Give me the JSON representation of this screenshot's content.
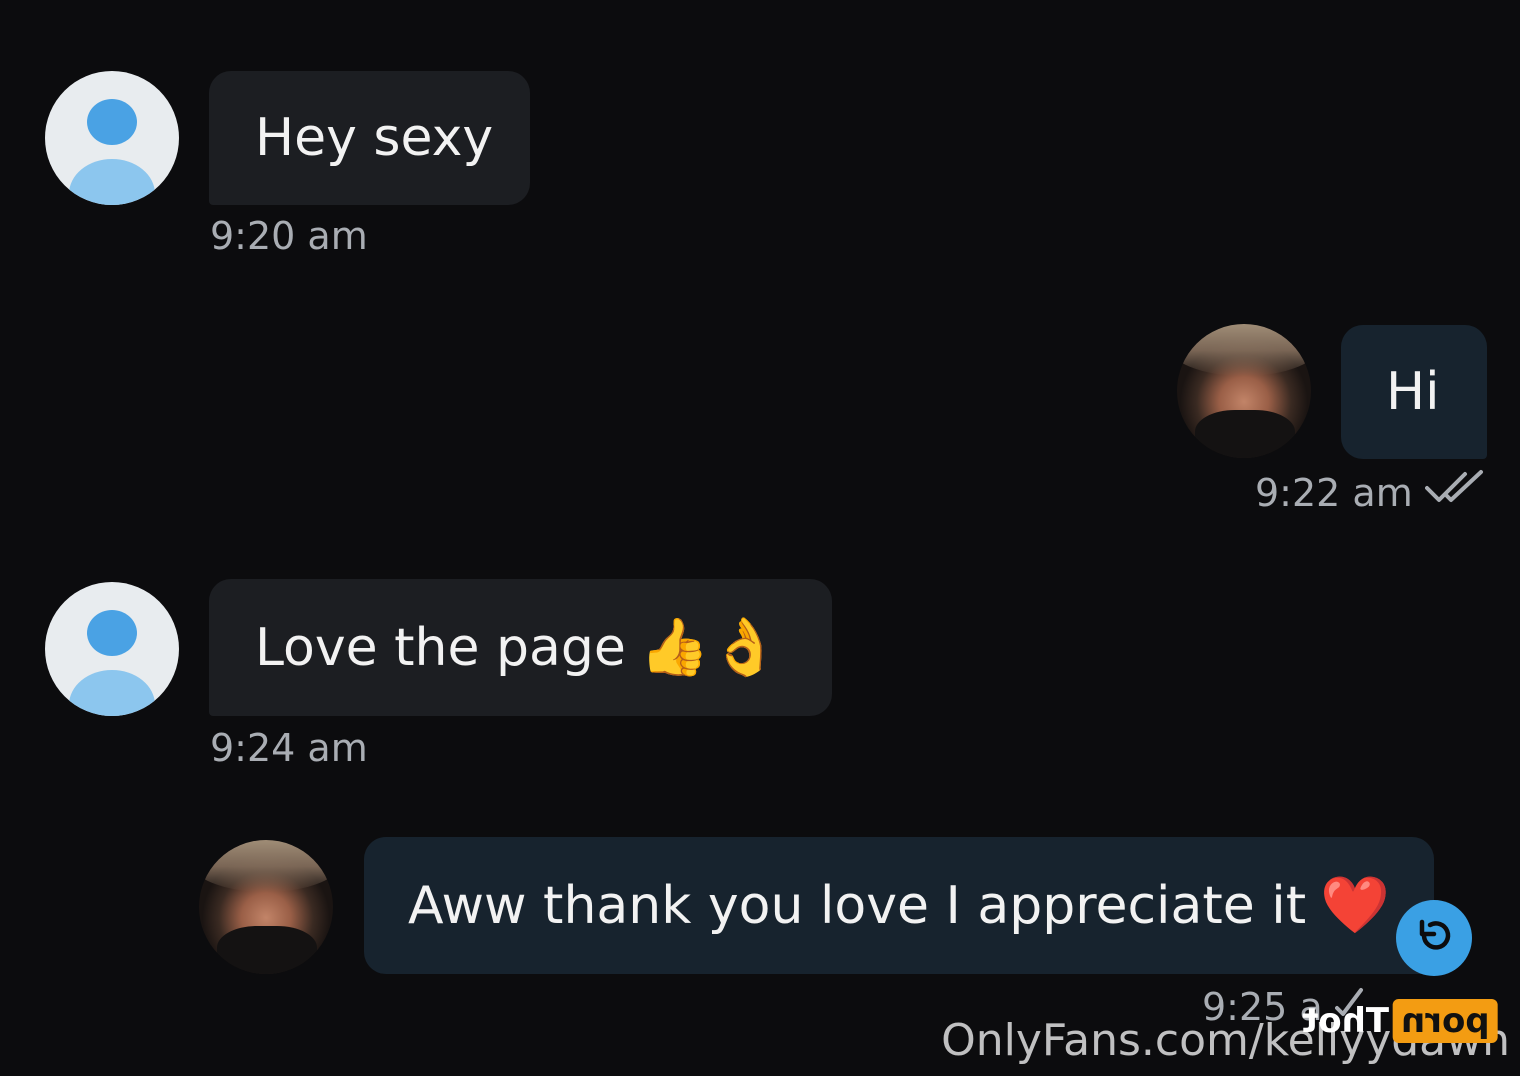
{
  "messages": [
    {
      "direction": "incoming",
      "text": "Hey sexy",
      "emoji": "",
      "time": "9:20 am"
    },
    {
      "direction": "outgoing",
      "text": "Hi",
      "emoji": "",
      "time": "9:22 am"
    },
    {
      "direction": "incoming",
      "text": "Love the page",
      "emoji": "👍👌",
      "time": "9:24 am"
    },
    {
      "direction": "outgoing",
      "text": "Aww thank you love I appreciate it",
      "emoji": "❤️",
      "time": "9:25 a"
    }
  ],
  "watermark": {
    "site_text": "OnlyFans.com/kellyydawn",
    "badge_orange": "porn",
    "badge_white": "Thot"
  },
  "colors": {
    "background": "#0c0c0e",
    "incoming_bubble": "#1c1e22",
    "outgoing_bubble": "#17232e",
    "accent_blue": "#3aa0e4",
    "badge_orange": "#f39c12"
  },
  "icons": {
    "read_receipt": "double-check-icon",
    "sent_receipt": "check-icon",
    "undo": "undo-icon",
    "default_avatar": "default-user-avatar-icon"
  }
}
